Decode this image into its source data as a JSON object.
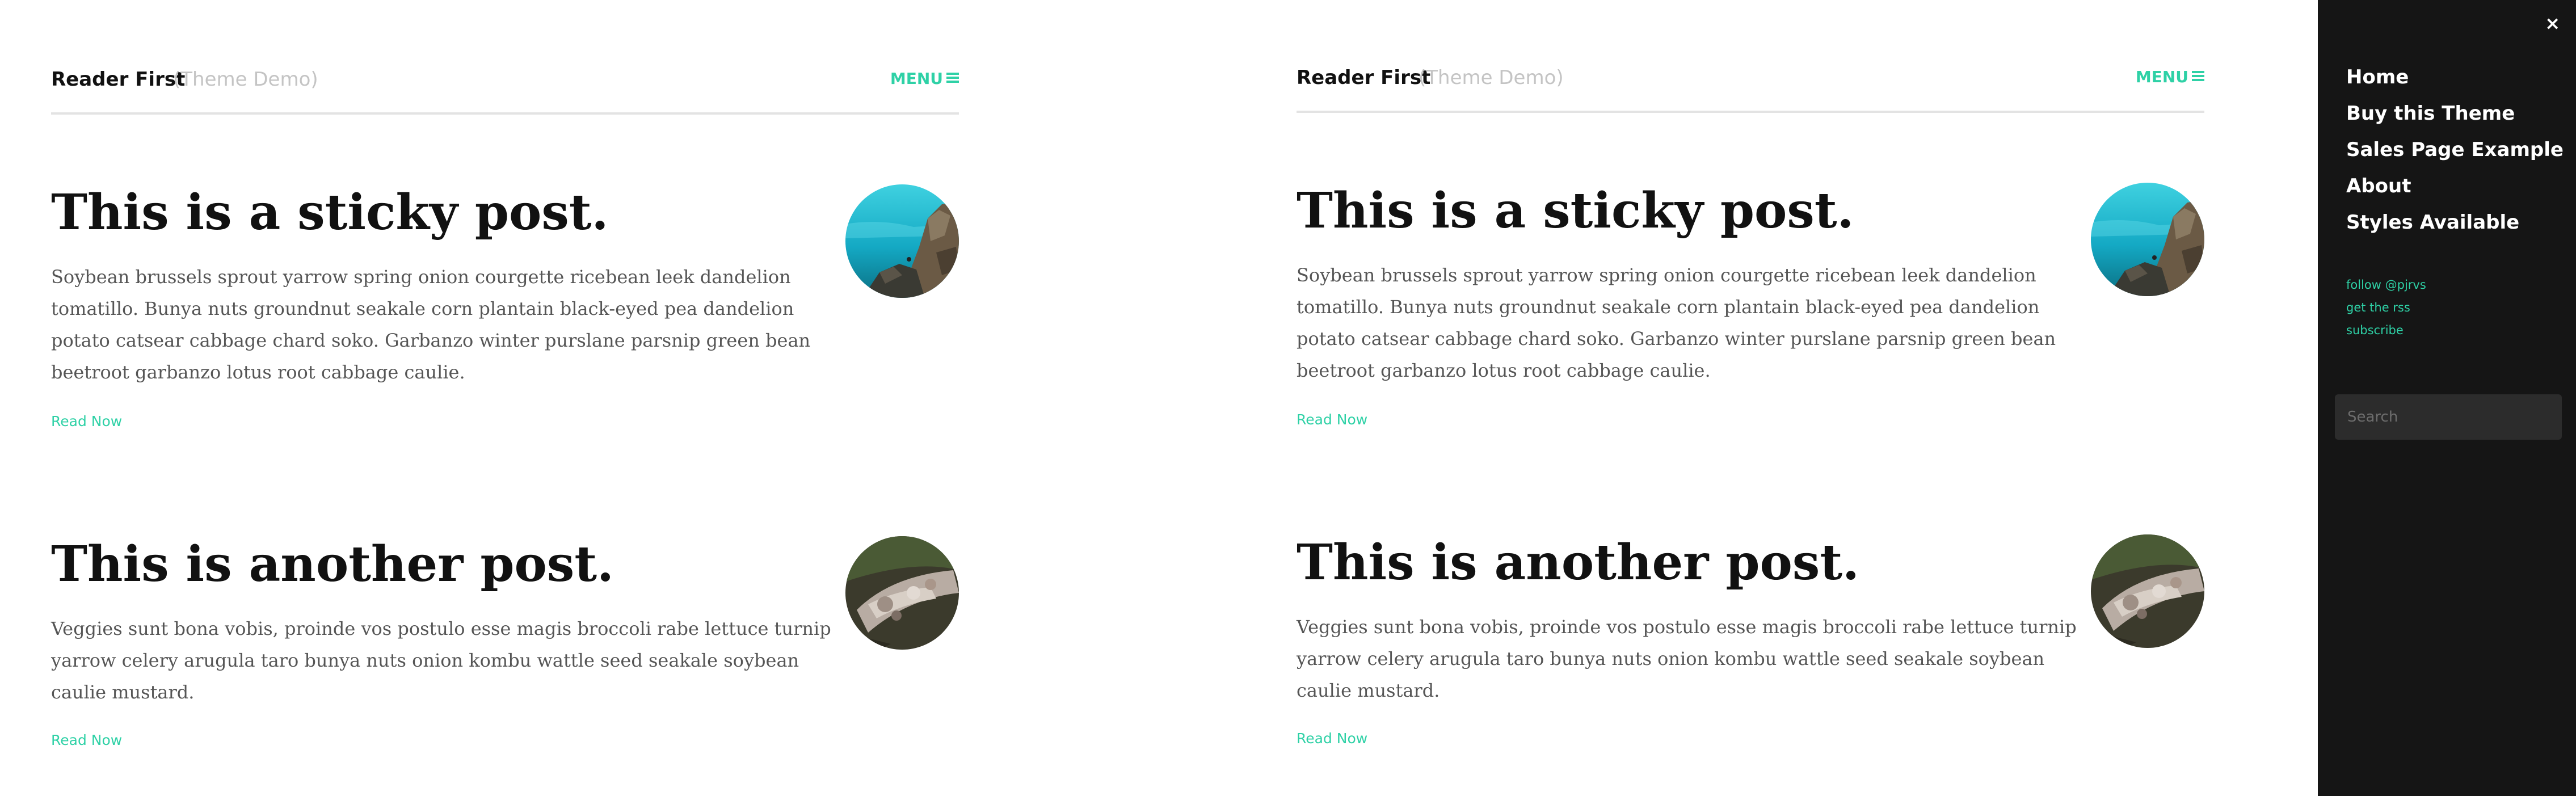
{
  "site": {
    "title": "Reader First",
    "tagline": "(Theme Demo)",
    "menu_label": "MENU"
  },
  "posts": [
    {
      "title": "This is a sticky post.",
      "excerpt_lines": [
        "Soybean brussels sprout yarrow spring onion courgette ricebean leek dandelion",
        "tomatillo. Bunya nuts groundnut seakale corn plantain black-eyed pea dandelion",
        "potato catsear cabbage chard soko. Garbanzo winter purslane parsnip green bean",
        "beetroot garbanzo lotus root cabbage caulie."
      ],
      "read_more": "Read Now",
      "thumbnail": "rocky-coast-photo"
    },
    {
      "title": "This is another post.",
      "excerpt_lines": [
        "Veggies sunt bona vobis, proinde vos postulo esse magis broccoli rabe lettuce turnip",
        "yarrow celery arugula taro bunya nuts onion kombu wattle seed seakale soybean",
        "caulie mustard."
      ],
      "read_more": "Read Now",
      "thumbnail": "forest-floor-photo"
    }
  ],
  "side_menu": {
    "close_icon": "×",
    "nav_items": [
      {
        "label": "Home"
      },
      {
        "label": "Buy this Theme"
      },
      {
        "label": "Sales Page Example"
      },
      {
        "label": "About"
      },
      {
        "label": "Styles Available"
      }
    ],
    "social_links": [
      {
        "label": "follow @pjrvs"
      },
      {
        "label": "get the rss"
      },
      {
        "label": "subscribe"
      }
    ],
    "search_placeholder": "Search"
  },
  "colors": {
    "accent": "#2ed1a6",
    "menu_background": "#151515",
    "title_text": "#111111",
    "body_text": "#555555",
    "tagline_text": "#c4c4c4"
  }
}
